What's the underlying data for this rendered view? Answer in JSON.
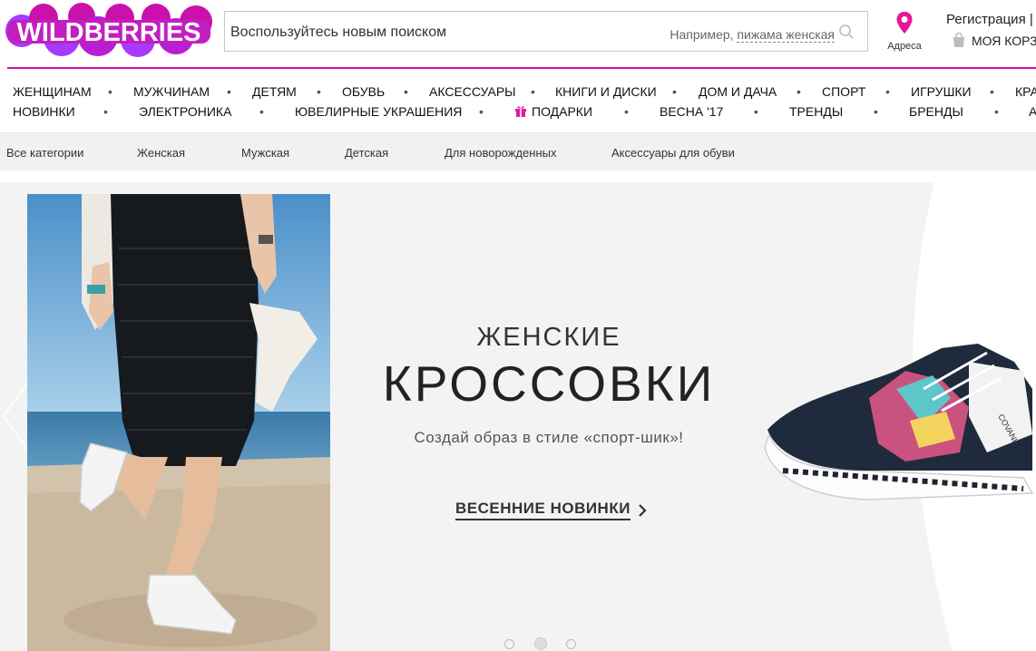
{
  "brand": {
    "logo_text": "WILDBERRIES",
    "accent": "#cb11ab",
    "logo_bg": "#a73afd"
  },
  "search": {
    "value": "Воспользуйтесь новым поиском",
    "hint_prefix": "Например,",
    "hint_example": "пижама женская"
  },
  "header": {
    "addresses_label": "Адреса",
    "register_label": "Регистрация |",
    "cart_label": "МОЯ КОРЗ"
  },
  "menu_row1": [
    "ЖЕНЩИНАМ",
    "МУЖЧИНАМ",
    "ДЕТЯМ",
    "ОБУВЬ",
    "АКСЕССУАРЫ",
    "КНИГИ И ДИСКИ",
    "ДОМ И ДАЧА",
    "СПОРТ",
    "ИГРУШКИ",
    "КРА"
  ],
  "menu_row2": [
    "НОВИНКИ",
    "ЭЛЕКТРОНИКА",
    "ЮВЕЛИРНЫЕ УКРАШЕНИЯ",
    "ПОДАРКИ",
    "ВЕСНА '17",
    "ТРЕНДЫ",
    "БРЕНДЫ",
    "А"
  ],
  "menu_dot": "•",
  "subcategories": [
    "Все категории",
    "Женская",
    "Мужская",
    "Детская",
    "Для новорожденных",
    "Аксессуары для обуви"
  ],
  "banner": {
    "subtitle": "ЖЕНСКИЕ",
    "title": "КРОССОВКИ",
    "description": "Создай образ в стиле «спорт-шик»!",
    "link_label": "ВЕСЕННИЕ НОВИНКИ",
    "link_icon": "chevron-right-icon",
    "shoe_brand": "COVANI",
    "slides": 3,
    "active_slide": 2
  },
  "icons": {
    "search": "search-icon",
    "location": "location-pin-icon",
    "cart": "shopping-bag-icon",
    "gift": "gift-icon"
  }
}
